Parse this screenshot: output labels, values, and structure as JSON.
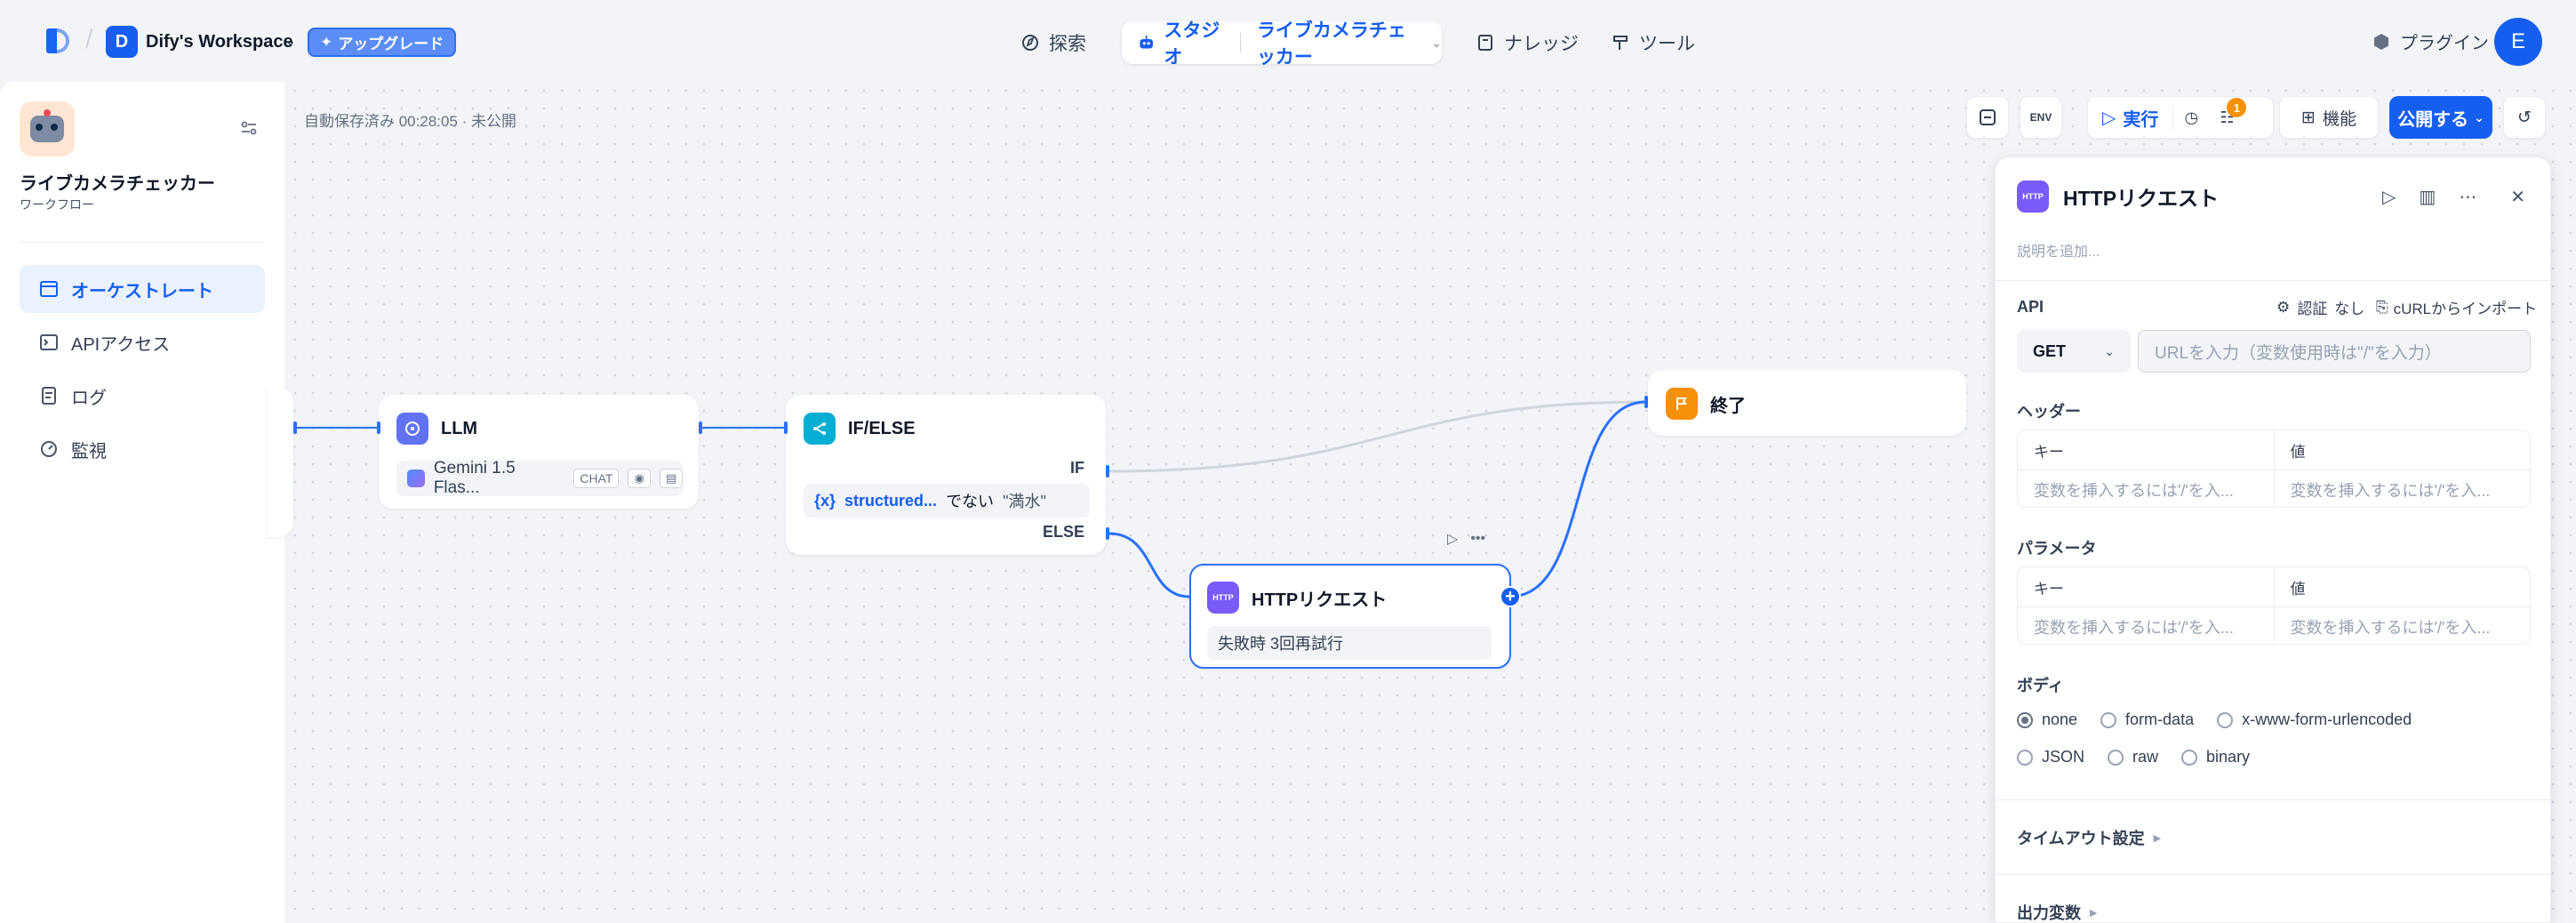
{
  "topbar": {
    "workspace_initial": "D",
    "workspace_name": "Dify's Workspace",
    "upgrade_label": "アップグレード",
    "nav": {
      "explore": "探索",
      "studio": "スタジオ",
      "studio_app": "ライブカメラチェッカー",
      "knowledge": "ナレッジ",
      "tools": "ツール"
    },
    "plugin_label": "プラグイン",
    "user_initial": "E"
  },
  "sidebar": {
    "app_title": "ライブカメラチェッカー",
    "app_type": "ワークフロー",
    "items": [
      {
        "label": "オーケストレート",
        "icon": "terminal-window-icon"
      },
      {
        "label": "APIアクセス",
        "icon": "terminal-icon"
      },
      {
        "label": "ログ",
        "icon": "file-list-icon"
      },
      {
        "label": "監視",
        "icon": "dashboard-icon"
      }
    ]
  },
  "canvas": {
    "autosave": "自動保存済み 00:28:05 · 未公開",
    "toolbar": {
      "env_label": "ENV",
      "run_label": "実行",
      "checklist_badge": "1",
      "features_label": "機能",
      "publish_label": "公開する"
    },
    "nodes": {
      "llm": {
        "title": "LLM",
        "model": "Gemini 1.5 Flas...",
        "mode": "CHAT"
      },
      "ifelse": {
        "title": "IF/ELSE",
        "if_label": "IF",
        "else_label": "ELSE",
        "var_prefix": "{x}",
        "var": "structured...",
        "operator": "でない",
        "value": "\"満水\""
      },
      "http": {
        "title": "HTTPリクエスト",
        "icon_text": "HTTP",
        "retry": "失敗時 3回再試行"
      },
      "end": {
        "title": "終了"
      }
    }
  },
  "panel": {
    "title": "HTTPリクエスト",
    "icon_text": "HTTP",
    "description_placeholder": "説明を追加...",
    "api_label": "API",
    "auth_label": "認証",
    "auth_value": "なし",
    "curl_label": "cURLからインポート",
    "method": "GET",
    "url_placeholder": "URLを入力（変数使用時は\"/\"を入力）",
    "headers_label": "ヘッダー",
    "params_label": "パラメータ",
    "key_col": "キー",
    "value_col": "値",
    "kv_placeholder": "変数を挿入するには'/'を入...",
    "body_label": "ボディ",
    "body_options": [
      "none",
      "form-data",
      "x-www-form-urlencoded",
      "JSON",
      "raw",
      "binary"
    ],
    "body_selected": "none",
    "timeout_label": "タイムアウト設定",
    "output_label": "出力変数"
  },
  "colors": {
    "accent": "#155eef",
    "llm_icon": "#6172f3",
    "ifelse_icon": "#06aed4",
    "http_icon": "#7a5af8",
    "end_icon": "#f79009"
  }
}
